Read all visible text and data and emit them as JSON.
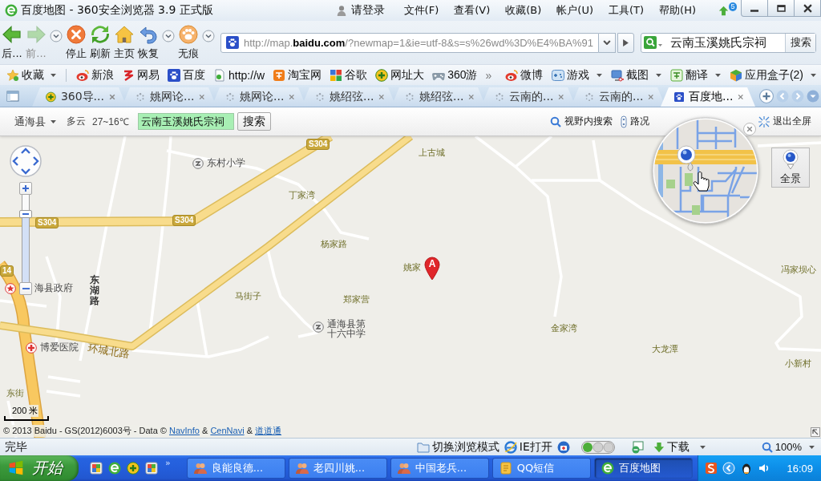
{
  "window": {
    "title": "百度地图 - 360安全浏览器 3.9 正式版",
    "login": "请登录",
    "menu": [
      "文件(F)",
      "查看(V)",
      "收藏(B)",
      "帐户(U)",
      "工具(T)",
      "帮助(H)"
    ],
    "update_count": "5"
  },
  "toolbar": {
    "buttons": [
      {
        "kind": "back",
        "label": "后...",
        "disabled": false
      },
      {
        "kind": "forward",
        "label": "前...",
        "disabled": true
      },
      {
        "kind": "menu"
      },
      {
        "kind": "stop",
        "label": "停止",
        "disabled": false
      },
      {
        "kind": "refresh",
        "label": "刷新",
        "disabled": false
      },
      {
        "kind": "home",
        "label": "主页",
        "disabled": false
      },
      {
        "kind": "restore",
        "label": "恢复",
        "disabled": false
      },
      {
        "kind": "menu"
      },
      {
        "kind": "incognito",
        "label": "无痕",
        "disabled": false
      },
      {
        "kind": "menu"
      }
    ],
    "address": {
      "url": "http://map.**baidu.com**/?newmap=1&ie=utf-8&s=s%26wd%3D%E4%BA%91"
    },
    "search": {
      "value": "云南玉溪姚氏宗祠",
      "button": "搜索"
    }
  },
  "bookmarks": {
    "favorites": "收藏",
    "sites": [
      "新浪",
      "网易",
      "百度",
      "http://w",
      "淘宝网",
      "谷歌",
      "网址大",
      "360游"
    ],
    "more": "»",
    "tools": [
      {
        "label": "微博",
        "dropdown": false
      },
      {
        "label": "游戏",
        "dropdown": true
      },
      {
        "label": "截图",
        "dropdown": true
      },
      {
        "label": "翻译",
        "dropdown": true
      },
      {
        "label": "应用盒子(2)",
        "dropdown": true
      }
    ]
  },
  "tabs": [
    {
      "label": "360导...",
      "selected": false
    },
    {
      "label": "姚网论...",
      "selected": false
    },
    {
      "label": "姚网论...",
      "selected": false
    },
    {
      "label": "姚绍弦...",
      "selected": false
    },
    {
      "label": "姚绍弦...",
      "selected": false
    },
    {
      "label": "云南的...",
      "selected": false
    },
    {
      "label": "云南的...",
      "selected": false
    },
    {
      "label": "百度地...",
      "selected": true
    }
  ],
  "map_page": {
    "toolbar": {
      "city": "通海县",
      "weather": "多云",
      "temperature": "27~16℃",
      "search_value": "云南玉溪姚氏宗祠",
      "search_button": "搜索",
      "links": [
        "视野内搜索",
        "路况",
        "退出全屏"
      ]
    },
    "labels": [
      {
        "text": "上古城",
        "kind": "place"
      },
      {
        "text": "东村小学",
        "kind": "school"
      },
      {
        "text": "丁家湾",
        "kind": "place"
      },
      {
        "text": "杨家路",
        "kind": "place"
      },
      {
        "text": "姚家",
        "kind": "place"
      },
      {
        "text": "冯家坝心",
        "kind": "place"
      },
      {
        "text": "海县政府",
        "kind": "government"
      },
      {
        "text": "东湖路",
        "kind": "road"
      },
      {
        "text": "马街子",
        "kind": "place"
      },
      {
        "text": "郑家营",
        "kind": "place"
      },
      {
        "text": "通海县第十六中学",
        "kind": "school"
      },
      {
        "text": "金家湾",
        "kind": "place"
      },
      {
        "text": "博爱医院",
        "kind": "hospital"
      },
      {
        "text": "环城北路",
        "kind": "road"
      },
      {
        "text": "大龙潭",
        "kind": "place"
      },
      {
        "text": "小新村",
        "kind": "place"
      },
      {
        "text": "东街",
        "kind": "place"
      }
    ],
    "road_signs": [
      "S304",
      "S304",
      "S304",
      "14"
    ],
    "marker": "A",
    "scale": "200 米",
    "copyright": [
      {
        "kind": "text",
        "text": "© 2013 Baidu - GS(2012)6003号 - Data ©"
      },
      {
        "kind": "link",
        "text": "NavInfo"
      },
      {
        "kind": "text",
        "text": "&"
      },
      {
        "kind": "link",
        "text": "CenNavi"
      },
      {
        "kind": "text",
        "text": "&"
      },
      {
        "kind": "link",
        "text": "道道通"
      }
    ],
    "panorama_button": "全景",
    "zoom_slider": {
      "level": 0.78
    }
  },
  "status_bar": {
    "text": "完毕",
    "items": [
      "切换浏览模式",
      "IE打开"
    ],
    "download": "下载",
    "zoom": "100%"
  },
  "taskbar": {
    "start": "开始",
    "more": "»",
    "tasks": [
      {
        "label": "良能良德...",
        "selected": false
      },
      {
        "label": "老四川姚...",
        "selected": false
      },
      {
        "label": "中国老兵...",
        "selected": false
      },
      {
        "label": "QQ短信",
        "selected": false
      },
      {
        "label": "百度地图",
        "selected": true
      }
    ],
    "clock": "16:09"
  }
}
